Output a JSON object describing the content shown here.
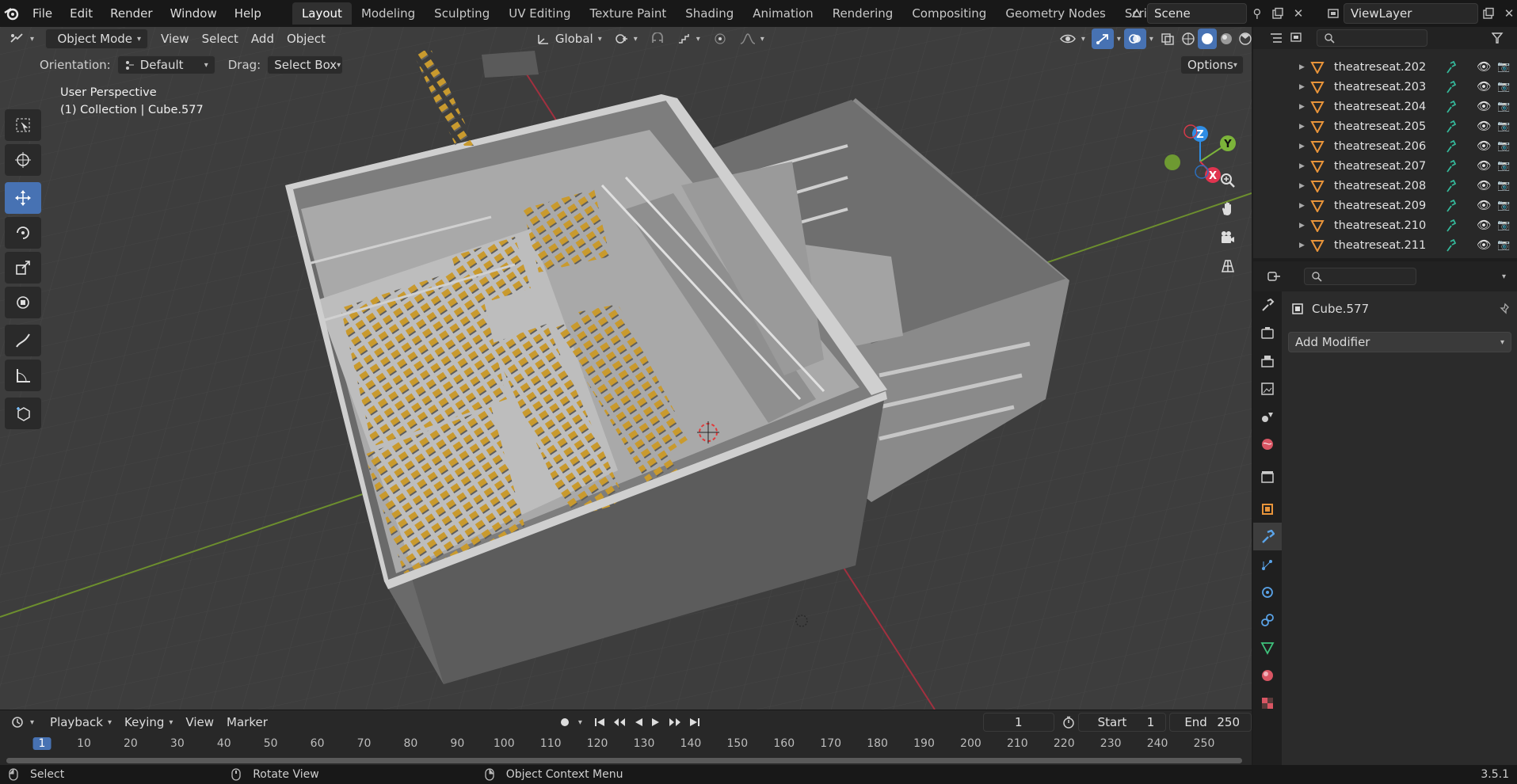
{
  "topbar": {
    "menu": [
      "File",
      "Edit",
      "Render",
      "Window",
      "Help"
    ],
    "workspaces": [
      "Layout",
      "Modeling",
      "Sculpting",
      "UV Editing",
      "Texture Paint",
      "Shading",
      "Animation",
      "Rendering",
      "Compositing",
      "Geometry Nodes",
      "Scripting"
    ],
    "active_workspace": "Layout",
    "scene": "Scene",
    "view_layer": "ViewLayer"
  },
  "viewport_header": {
    "mode": "Object Mode",
    "menus": [
      "View",
      "Select",
      "Add",
      "Object"
    ],
    "transform_orientation": "Global"
  },
  "tool_settings": {
    "orientation_label": "Orientation:",
    "orientation_value": "Default",
    "drag_label": "Drag:",
    "drag_value": "Select Box",
    "options": "Options"
  },
  "viewport_info": {
    "perspective": "User Perspective",
    "collection": "(1) Collection | Cube.577"
  },
  "gizmo": {
    "z": "Z",
    "y": "Y",
    "x": "X"
  },
  "outliner": {
    "rows": [
      "theatreseat.202",
      "theatreseat.203",
      "theatreseat.204",
      "theatreseat.205",
      "theatreseat.206",
      "theatreseat.207",
      "theatreseat.208",
      "theatreseat.209",
      "theatreseat.210",
      "theatreseat.211"
    ]
  },
  "properties": {
    "object_name": "Cube.577",
    "add_modifier": "Add Modifier"
  },
  "timeline": {
    "menus": [
      "Playback",
      "Keying",
      "View",
      "Marker"
    ],
    "current_frame": "1",
    "start_label": "Start",
    "start_value": "1",
    "end_label": "End",
    "end_value": "250",
    "ruler": [
      "1",
      "10",
      "20",
      "30",
      "40",
      "50",
      "60",
      "70",
      "80",
      "90",
      "100",
      "110",
      "120",
      "130",
      "140",
      "150",
      "160",
      "170",
      "180",
      "190",
      "200",
      "210",
      "220",
      "230",
      "240",
      "250"
    ]
  },
  "statusbar": {
    "select": "Select",
    "rotate": "Rotate View",
    "context": "Object Context Menu",
    "version": "3.5.1"
  },
  "colors": {
    "accent": "#4772b3",
    "seat": "#c99a2e",
    "x_axis": "#e0344f",
    "y_axis": "#7cb43a",
    "z_axis": "#2f8de4"
  }
}
